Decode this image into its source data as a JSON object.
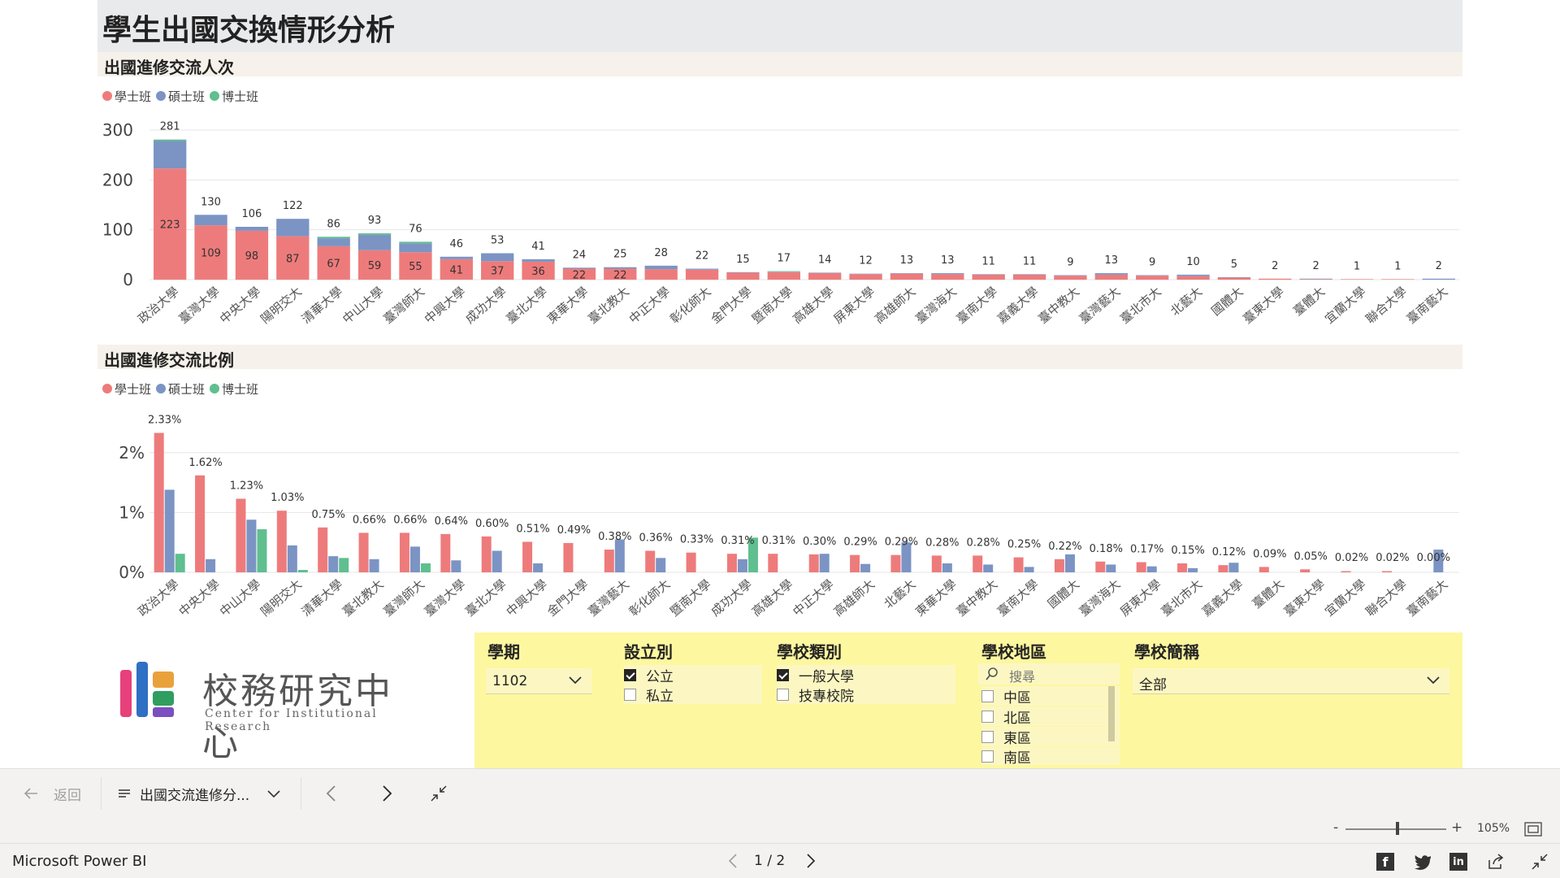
{
  "page_title": "學生出國交換情形分析",
  "colors": {
    "bachelor": "#ee7b7b",
    "master": "#7b94c4",
    "doctor": "#5fbf8f",
    "filter_bg": "#fdf79f"
  },
  "chart1": {
    "title": "出國進修交流人次",
    "legend": [
      "學士班",
      "碩士班",
      "博士班"
    ],
    "y_ticks": [
      "300",
      "200",
      "100",
      "0"
    ],
    "ylim": [
      0,
      300
    ],
    "categories": [
      "政治大學",
      "臺灣大學",
      "中央大學",
      "陽明交大",
      "清華大學",
      "中山大學",
      "臺灣師大",
      "中興大學",
      "成功大學",
      "臺北大學",
      "東華大學",
      "臺北教大",
      "中正大學",
      "彰化師大",
      "金門大學",
      "暨南大學",
      "高雄大學",
      "屏東大學",
      "高雄師大",
      "臺灣海大",
      "臺南大學",
      "嘉義大學",
      "臺中教大",
      "臺灣藝大",
      "臺北市大",
      "北藝大",
      "國體大",
      "臺東大學",
      "臺體大",
      "宜蘭大學",
      "聯合大學",
      "臺南藝大"
    ],
    "totals": [
      "281",
      "130",
      "106",
      "122",
      "86",
      "93",
      "76",
      "46",
      "53",
      "41",
      "24",
      "25",
      "28",
      "22",
      "15",
      "17",
      "14",
      "12",
      "13",
      "13",
      "11",
      "11",
      "9",
      "13",
      "9",
      "10",
      "5",
      "2",
      "2",
      "1",
      "1",
      "2"
    ],
    "bachelor_labels": [
      "223",
      "109",
      "98",
      "87",
      "67",
      "59",
      "55",
      "41",
      "37",
      "36",
      "22",
      "22"
    ],
    "series": [
      {
        "name": "學士班",
        "values": [
          223,
          109,
          98,
          87,
          67,
          59,
          55,
          41,
          37,
          36,
          22,
          22,
          21,
          20,
          14,
          15,
          13,
          11,
          12,
          11,
          10,
          10,
          8,
          10,
          8,
          7,
          4,
          2,
          1,
          1,
          1,
          0
        ]
      },
      {
        "name": "碩士班",
        "values": [
          55,
          21,
          8,
          35,
          16,
          31,
          18,
          5,
          16,
          5,
          2,
          3,
          7,
          2,
          1,
          1,
          1,
          1,
          1,
          2,
          1,
          1,
          1,
          3,
          1,
          3,
          1,
          0,
          1,
          0,
          0,
          2
        ]
      },
      {
        "name": "博士班",
        "values": [
          3,
          0,
          0,
          0,
          3,
          3,
          3,
          0,
          0,
          0,
          0,
          0,
          0,
          0,
          0,
          1,
          0,
          0,
          0,
          0,
          0,
          0,
          0,
          0,
          0,
          0,
          0,
          0,
          0,
          0,
          0,
          0
        ]
      }
    ]
  },
  "chart2": {
    "title": "出國進修交流比例",
    "legend": [
      "學士班",
      "碩士班",
      "博士班"
    ],
    "y_ticks": [
      "2%",
      "1%",
      "0%"
    ],
    "ylim": [
      0,
      2.5
    ],
    "categories": [
      "政治大學",
      "中央大學",
      "中山大學",
      "陽明交大",
      "清華大學",
      "臺北教大",
      "臺灣師大",
      "臺灣大學",
      "臺北大學",
      "中興大學",
      "金門大學",
      "臺灣藝大",
      "彰化師大",
      "暨南大學",
      "成功大學",
      "高雄大學",
      "中正大學",
      "高雄師大",
      "北藝大",
      "東華大學",
      "臺中教大",
      "臺南大學",
      "國體大",
      "臺灣海大",
      "屏東大學",
      "臺北市大",
      "嘉義大學",
      "臺體大",
      "臺東大學",
      "宜蘭大學",
      "聯合大學",
      "臺南藝大"
    ],
    "labels": [
      "2.33%",
      "1.62%",
      "1.23%",
      "1.03%",
      "0.75%",
      "0.66%",
      "0.66%",
      "0.64%",
      "0.60%",
      "0.51%",
      "0.49%",
      "0.38%",
      "0.36%",
      "0.33%",
      "0.31%",
      "0.31%",
      "0.30%",
      "0.29%",
      "0.29%",
      "0.28%",
      "0.28%",
      "0.25%",
      "0.22%",
      "0.18%",
      "0.17%",
      "0.15%",
      "0.12%",
      "0.09%",
      "0.05%",
      "0.02%",
      "0.02%",
      "0.00%"
    ],
    "series": [
      {
        "name": "學士班",
        "values": [
          2.33,
          1.62,
          1.23,
          1.03,
          0.75,
          0.66,
          0.66,
          0.64,
          0.6,
          0.51,
          0.49,
          0.38,
          0.36,
          0.33,
          0.31,
          0.31,
          0.3,
          0.29,
          0.29,
          0.28,
          0.28,
          0.25,
          0.22,
          0.18,
          0.17,
          0.15,
          0.12,
          0.09,
          0.05,
          0.02,
          0.02,
          0.0
        ]
      },
      {
        "name": "碩士班",
        "values": [
          1.38,
          0.22,
          0.88,
          0.45,
          0.27,
          0.22,
          0.43,
          0.2,
          0.36,
          0.15,
          0.0,
          0.55,
          0.24,
          0.0,
          0.22,
          0.0,
          0.31,
          0.14,
          0.5,
          0.15,
          0.13,
          0.09,
          0.3,
          0.13,
          0.1,
          0.07,
          0.16,
          0.0,
          0.0,
          0.0,
          0.0,
          0.38
        ]
      },
      {
        "name": "博士班",
        "values": [
          0.31,
          0.0,
          0.72,
          0.04,
          0.24,
          0.0,
          0.15,
          0.0,
          0.0,
          0.0,
          0.0,
          0.0,
          0.0,
          0.0,
          0.58,
          0.0,
          0.0,
          0.0,
          0.0,
          0.0,
          0.0,
          0.0,
          0.0,
          0.0,
          0.0,
          0.0,
          0.0,
          0.0,
          0.0,
          0.0,
          0.0,
          0.0
        ]
      }
    ]
  },
  "logo": {
    "main_text": "校務研究中心",
    "sub_text": "Center for Institutional Research"
  },
  "filters": {
    "semester": {
      "title": "學期",
      "value": "1102"
    },
    "establishment": {
      "title": "設立別",
      "options": [
        {
          "label": "公立",
          "checked": true
        },
        {
          "label": "私立",
          "checked": false
        }
      ]
    },
    "school_type": {
      "title": "學校類別",
      "options": [
        {
          "label": "一般大學",
          "checked": true
        },
        {
          "label": "技專校院",
          "checked": false
        }
      ]
    },
    "region": {
      "title": "學校地區",
      "search_placeholder": "搜尋",
      "options": [
        {
          "label": "中區",
          "checked": false
        },
        {
          "label": "北區",
          "checked": false
        },
        {
          "label": "東區",
          "checked": false
        },
        {
          "label": "南區",
          "checked": false
        }
      ]
    },
    "school_name": {
      "title": "學校簡稱",
      "value": "全部"
    }
  },
  "navbar": {
    "back_label": "返回",
    "page_name": "出國交流進修分..."
  },
  "zoom": {
    "level": "105%",
    "minus": "-",
    "plus": "+"
  },
  "status": {
    "app_name": "Microsoft Power BI",
    "page_indicator": "1 / 2"
  }
}
